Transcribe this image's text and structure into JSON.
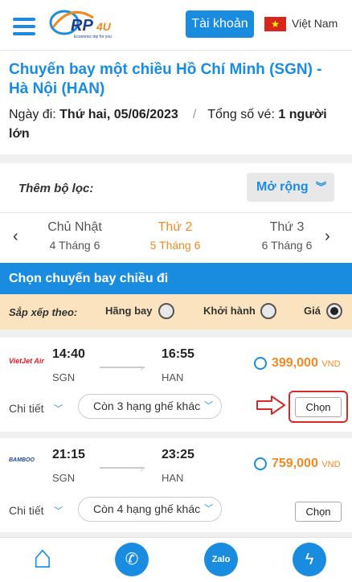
{
  "header": {
    "menu_icon": "hamburger-menu-icon",
    "logo_tagline": "Economic trip for you",
    "account_label": "Tài khoản",
    "language_flag": "vietnam-flag-icon",
    "language_label": "Việt Nam"
  },
  "trip": {
    "title": "Chuyến bay một chiều Hồ Chí Minh (SGN) - Hà Nội (HAN)",
    "date_label": "Ngày đi:",
    "date_value": "Thứ hai, 05/06/2023",
    "tickets_label": "Tổng số vé:",
    "tickets_value": "1 người lớn"
  },
  "filter": {
    "label": "Thêm bộ lọc:",
    "expand_label": "Mở rộng"
  },
  "date_nav": {
    "days": [
      {
        "name": "Chủ Nhật",
        "date": "4 Tháng 6"
      },
      {
        "name": "Thứ 2",
        "date": "5 Tháng 6"
      },
      {
        "name": "Thứ 3",
        "date": "6 Tháng 6"
      }
    ]
  },
  "section_title": "Chọn chuyến bay chiều đi",
  "sort": {
    "label": "Sắp xếp theo:",
    "options": [
      "Hãng bay",
      "Khởi hành",
      "Giá"
    ],
    "selected": "Giá"
  },
  "flights": [
    {
      "airline": "VietJet Air",
      "depart_time": "14:40",
      "depart_code": "SGN",
      "arrive_time": "16:55",
      "arrive_code": "HAN",
      "price": "399,000",
      "currency": "VND",
      "detail_label": "Chi tiết",
      "seat_label": "Còn 3 hạng ghế khác",
      "choose_label": "Chọn"
    },
    {
      "airline": "BAMBOO",
      "depart_time": "21:15",
      "depart_code": "SGN",
      "arrive_time": "23:25",
      "arrive_code": "HAN",
      "price": "759,000",
      "currency": "VND",
      "detail_label": "Chi tiết",
      "seat_label": "Còn 4 hạng ghế khác",
      "choose_label": "Chọn"
    }
  ],
  "bottom_nav": {
    "zalo_label": "Zalo"
  },
  "colors": {
    "primary": "#1a8ce0",
    "accent": "#f08a24",
    "sort_bg": "#fbe3c0",
    "highlight": "#d42a2a"
  }
}
